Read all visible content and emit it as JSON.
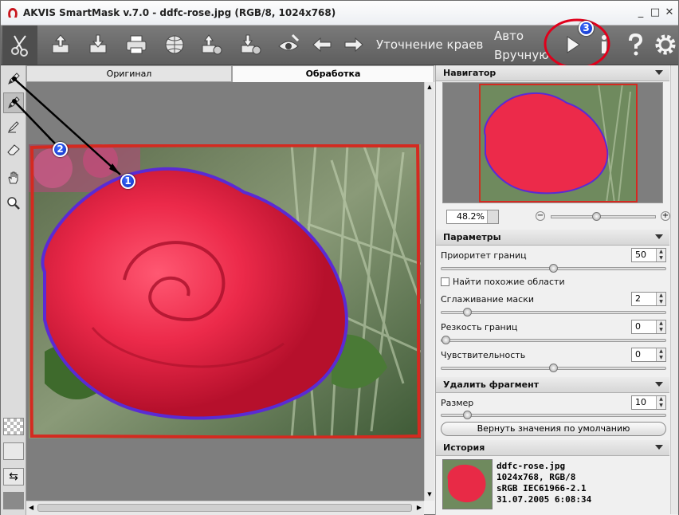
{
  "window": {
    "title": "AKVIS SmartMask v.7.0 - ddfc-rose.jpg (RGB/8, 1024x768)",
    "controls": [
      "_",
      "□",
      "✕"
    ]
  },
  "toolbar": {
    "refine_edges_label": "Уточнение краев",
    "mode_auto": "Авто",
    "mode_manual": "Вручную",
    "icons": [
      "scissors-icon",
      "open-icon",
      "save-icon",
      "print-icon",
      "web-icon",
      "import-icon",
      "export-icon",
      "preview-icon",
      "undo-icon",
      "redo-icon",
      "run-icon",
      "info-icon",
      "help-icon",
      "settings-icon"
    ]
  },
  "tabs": {
    "original": "Оригинал",
    "processing": "Обработка"
  },
  "annotations": [
    "1",
    "2",
    "3"
  ],
  "navigator": {
    "title": "Навигатор",
    "zoom": "48.2%",
    "zoom_level": 0.43
  },
  "params": {
    "title": "Параметры",
    "edge_priority": {
      "label": "Приоритет границ",
      "value": "50",
      "level": 0.5
    },
    "find_similar": {
      "label": "Найти похожие области",
      "checked": false
    },
    "mask_smoothing": {
      "label": "Сглаживание маски",
      "value": "2",
      "level": 0.1
    },
    "edge_sharpness": {
      "label": "Резкость границ",
      "value": "0",
      "level": 0.0
    },
    "sensitivity": {
      "label": "Чувствительность",
      "value": "0",
      "level": 0.5
    }
  },
  "delete_fragment": {
    "title": "Удалить фрагмент",
    "size_label": "Размер",
    "size_value": "10",
    "size_level": 0.1,
    "reset_button": "Вернуть значения по умолчанию"
  },
  "history": {
    "title": "История",
    "file": "ddfc-rose.jpg",
    "dims": "1024x768, RGB/8",
    "profile": "sRGB IEC61966-2.1",
    "date": "31.07.2005 6:08:34"
  },
  "colors": {
    "toolbar": "#6b6b6b",
    "annotation_blue": "#1a3fd6",
    "annotation_red": "#e0001b",
    "mask_outline": "#5a2bd4",
    "bg_stroke": "#d42a20"
  }
}
